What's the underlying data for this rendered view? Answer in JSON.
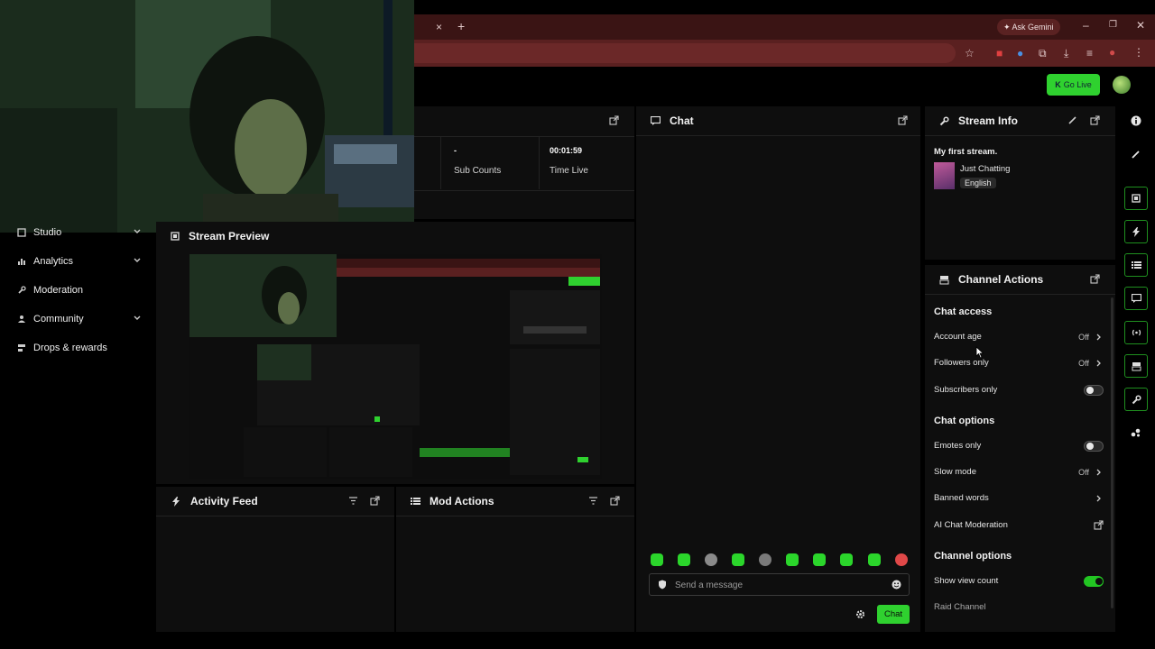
{
  "browser": {
    "new_tab_label": "+",
    "close_tab_label": "×",
    "ask_gemini": "Ask Gemini"
  },
  "topnav": {
    "go_live": "Go Live"
  },
  "sidebar": {
    "items": [
      {
        "label": "Studio",
        "icon": "studio-icon",
        "expandable": true
      },
      {
        "label": "Analytics",
        "icon": "analytics-icon",
        "expandable": true
      },
      {
        "label": "Moderation",
        "icon": "wrench-icon",
        "expandable": false
      },
      {
        "label": "Community",
        "icon": "community-icon",
        "expandable": true
      },
      {
        "label": "Drops & rewards",
        "icon": "drops-icon",
        "expandable": false
      }
    ]
  },
  "stats": {
    "sub_counts_value": "-",
    "sub_counts_label": "Sub Counts",
    "time_live_value": "00:01:59",
    "time_live_label": "Time Live"
  },
  "panels": {
    "stream_preview": "Stream Preview",
    "activity_feed": "Activity Feed",
    "mod_actions": "Mod Actions",
    "chat": "Chat",
    "stream_info": "Stream Info",
    "channel_actions": "Channel Actions"
  },
  "stream_info": {
    "title": "My first stream.",
    "category": "Just Chatting",
    "language_tag": "English"
  },
  "channel_actions": {
    "chat_access": {
      "heading": "Chat access",
      "rows": [
        {
          "label": "Account age",
          "value": "Off",
          "control": "arrow"
        },
        {
          "label": "Followers only",
          "value": "Off",
          "control": "arrow"
        },
        {
          "label": "Subscribers only",
          "value": "",
          "control": "toggle",
          "on": false
        }
      ]
    },
    "chat_options": {
      "heading": "Chat options",
      "rows": [
        {
          "label": "Emotes only",
          "value": "",
          "control": "toggle",
          "on": false
        },
        {
          "label": "Slow mode",
          "value": "Off",
          "control": "arrow"
        },
        {
          "label": "Banned words",
          "value": "",
          "control": "arrow"
        },
        {
          "label": "AI Chat Moderation",
          "value": "",
          "control": "external"
        }
      ]
    },
    "channel_options": {
      "heading": "Channel options",
      "rows": [
        {
          "label": "Show view count",
          "value": "",
          "control": "toggle",
          "on": true
        },
        {
          "label": "Raid Channel",
          "value": "",
          "control": "none"
        }
      ]
    }
  },
  "chat": {
    "placeholder": "Send a message",
    "send_label": "Chat"
  },
  "colors": {
    "accent": "#2fd12f",
    "panel_bg": "#0e0e0e",
    "browser_tab": "#3a1414",
    "browser_bar": "#5a2020"
  }
}
